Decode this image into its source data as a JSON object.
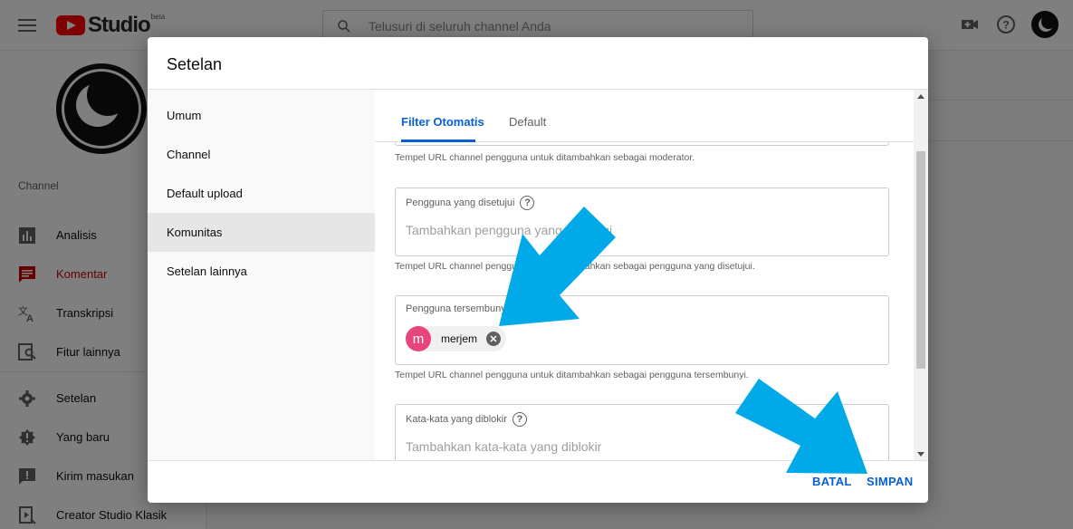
{
  "app": {
    "logo_text": "Studio",
    "logo_badge": "beta",
    "search_placeholder": "Telusuri di seluruh channel Anda"
  },
  "sidebar": {
    "section_heading": "Channel",
    "items": [
      {
        "label": "Analisis",
        "icon": "analytics-icon",
        "active": false
      },
      {
        "label": "Komentar",
        "icon": "comments-icon",
        "active": true
      },
      {
        "label": "Transkripsi",
        "icon": "translate-icon",
        "active": false
      },
      {
        "label": "Fitur lainnya",
        "icon": "more-features-icon",
        "active": false
      },
      {
        "label": "Setelan",
        "icon": "gear-icon",
        "active": false
      },
      {
        "label": "Yang baru",
        "icon": "whats-new-icon",
        "active": false
      },
      {
        "label": "Kirim masukan",
        "icon": "feedback-icon",
        "active": false
      },
      {
        "label": "Creator Studio Klasik",
        "icon": "classic-studio-icon",
        "active": false
      }
    ]
  },
  "dialog": {
    "title": "Setelan",
    "nav": [
      {
        "label": "Umum",
        "active": false
      },
      {
        "label": "Channel",
        "active": false
      },
      {
        "label": "Default upload",
        "active": false
      },
      {
        "label": "Komunitas",
        "active": true
      },
      {
        "label": "Setelan lainnya",
        "active": false
      }
    ],
    "tabs": [
      {
        "label": "Filter Otomatis",
        "active": true
      },
      {
        "label": "Default",
        "active": false
      }
    ],
    "fields": {
      "moderators_hint": "Tempel URL channel pengguna untuk ditambahkan sebagai moderator.",
      "approved": {
        "label": "Pengguna yang disetujui",
        "placeholder": "Tambahkan pengguna yang disetujui",
        "hint": "Tempel URL channel pengguna untuk ditambahkan sebagai pengguna yang disetujui."
      },
      "hidden": {
        "label": "Pengguna tersembunyi",
        "chip_initial": "m",
        "chip_name": "merjem",
        "hint": "Tempel URL channel pengguna untuk ditambahkan sebagai pengguna tersembunyi."
      },
      "blocked_words": {
        "label": "Kata-kata yang diblokir",
        "placeholder": "Tambahkan kata-kata yang diblokir"
      }
    },
    "footer": {
      "cancel": "BATAL",
      "save": "SIMPAN"
    }
  },
  "colors": {
    "accent": "#065fd4",
    "active_sidebar": "#cc0000",
    "chip_avatar": "#e8457a",
    "annotation_arrow": "#00a9e8"
  }
}
